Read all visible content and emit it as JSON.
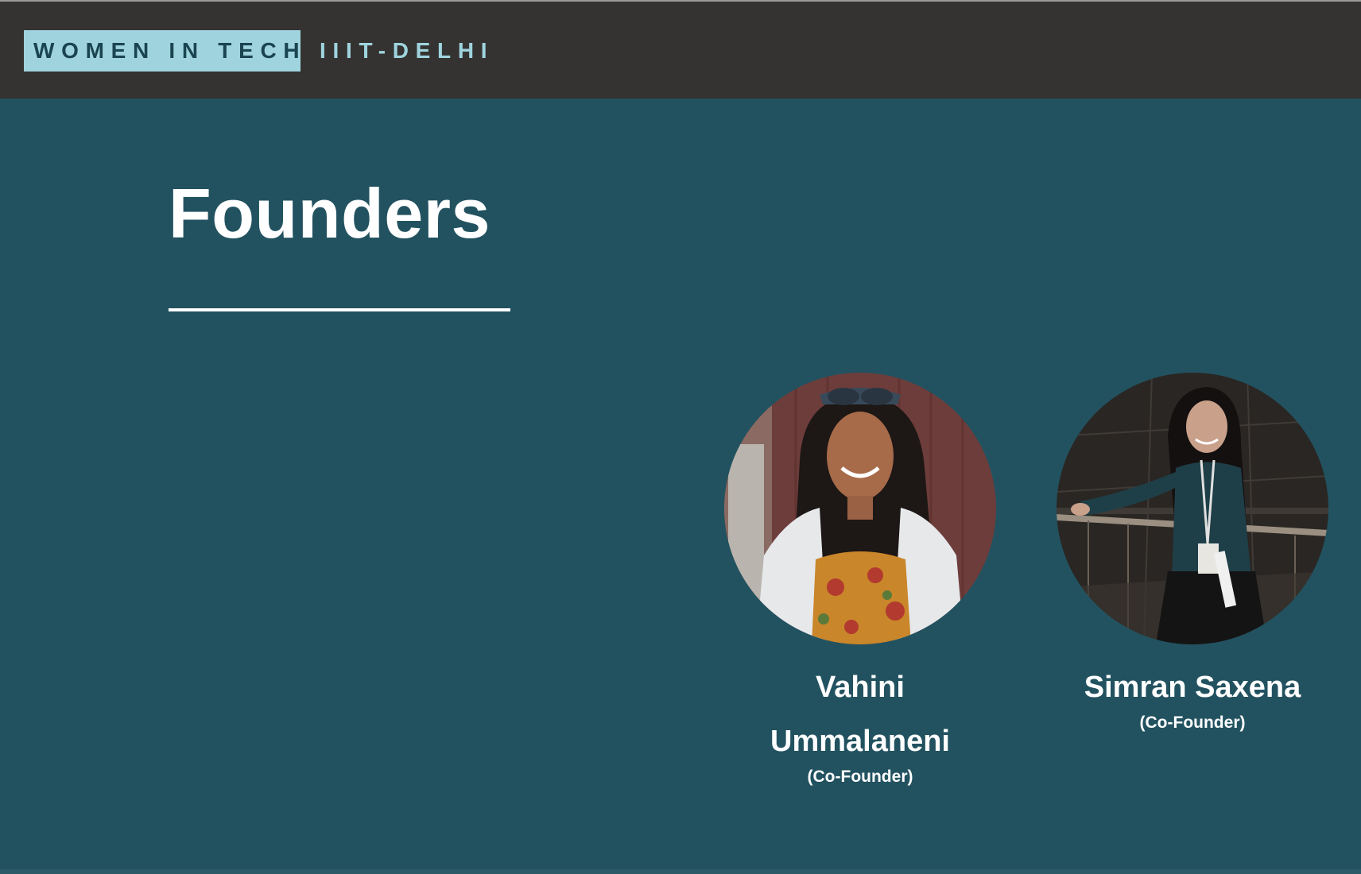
{
  "header": {
    "brand": "WOMEN IN TECH",
    "sub_brand": "IIIT-DELHI"
  },
  "main": {
    "title": "Founders",
    "founders": [
      {
        "name": "Vahini Ummalaneni",
        "role": "(Co-Founder)"
      },
      {
        "name": "Simran Saxena",
        "role": "(Co-Founder)"
      }
    ]
  },
  "colors": {
    "header_bg": "#343331",
    "brand_bg": "#9fd4de",
    "brand_text": "#1b4451",
    "page_bg": "#225260",
    "text": "#ffffff"
  }
}
